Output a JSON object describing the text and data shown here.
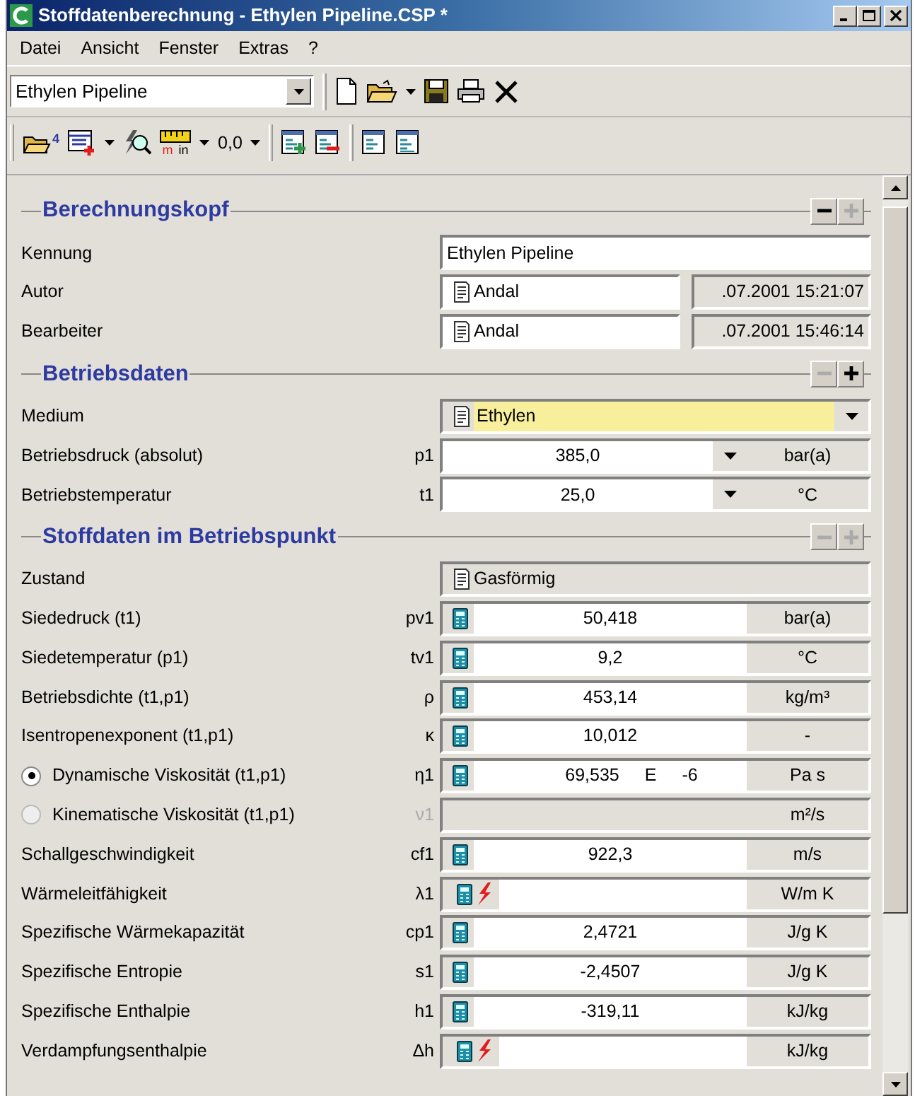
{
  "window": {
    "title": "Stoffdatenberechnung - Ethylen Pipeline.CSP *"
  },
  "menu": [
    "Datei",
    "Ansicht",
    "Fenster",
    "Extras",
    "?"
  ],
  "project_select": {
    "value": "Ethylen Pipeline"
  },
  "toolbar_2": {
    "recent_count": "4",
    "unit_metric": "m",
    "unit_imperial": "in",
    "number_format": "0,0"
  },
  "sections": [
    {
      "title": "Berechnungskopf",
      "collapse_enabled": true,
      "expand_enabled": false,
      "rows": [
        {
          "kind": "text",
          "label": "Kennung",
          "value": "Ethylen Pipeline"
        },
        {
          "kind": "person",
          "label": "Autor",
          "value": "Andal",
          "date": ".07.2001 15:21:07"
        },
        {
          "kind": "person",
          "label": "Bearbeiter",
          "value": "Andal",
          "date": ".07.2001 15:46:14"
        }
      ]
    },
    {
      "title": "Betriebsdaten",
      "collapse_enabled": false,
      "expand_enabled": true,
      "rows": [
        {
          "kind": "choice",
          "label": "Medium",
          "value": "Ethylen"
        },
        {
          "kind": "input",
          "label": "Betriebsdruck (absolut)",
          "symbol": "p1",
          "value": "385,0",
          "unit": "bar(a)"
        },
        {
          "kind": "input",
          "label": "Betriebstemperatur",
          "symbol": "t1",
          "value": "25,0",
          "unit": "°C"
        }
      ]
    },
    {
      "title": "Stoffdaten im Betriebspunkt",
      "collapse_enabled": false,
      "expand_enabled": false,
      "rows": [
        {
          "kind": "state",
          "label": "Zustand",
          "value": "Gasförmig"
        },
        {
          "kind": "calc",
          "label": "Siededruck (t1)",
          "symbol": "pv1",
          "value": "50,418",
          "unit": "bar(a)",
          "error": false
        },
        {
          "kind": "calc",
          "label": "Siedetemperatur (p1)",
          "symbol": "tv1",
          "value": "9,2",
          "unit": "°C",
          "error": false
        },
        {
          "kind": "calc",
          "label": "Betriebsdichte (t1,p1)",
          "symbol": "ρ",
          "value": "453,14",
          "unit": "kg/m³",
          "error": false
        },
        {
          "kind": "calc",
          "label": "Isentropenexponent (t1,p1)",
          "symbol": "κ",
          "value": "10,012",
          "unit": "-",
          "error": false
        },
        {
          "kind": "calc",
          "label": "Dynamische Viskosität (t1,p1)",
          "symbol": "η1",
          "value": "69,535",
          "exp_mark": "E",
          "exponent": "-6",
          "unit": "Pa s",
          "error": false,
          "radio": {
            "selected": true
          },
          "disabled": false
        },
        {
          "kind": "calc",
          "label": "Kinematische Viskosität (t1,p1)",
          "symbol": "ν1",
          "unit": "m²/s",
          "error": false,
          "radio": {
            "selected": false
          },
          "disabled": true
        },
        {
          "kind": "calc",
          "label": "Schallgeschwindigkeit",
          "symbol": "cf1",
          "value": "922,3",
          "unit": "m/s",
          "error": false
        },
        {
          "kind": "calc",
          "label": "Wärmeleitfähigkeit",
          "symbol": "λ1",
          "unit": "W/m K",
          "error": true
        },
        {
          "kind": "calc",
          "label": "Spezifische Wärmekapazität",
          "symbol": "cp1",
          "value": "2,4721",
          "unit": "J/g K",
          "error": false
        },
        {
          "kind": "calc",
          "label": "Spezifische Entropie",
          "symbol": "s1",
          "value": "-2,4507",
          "unit": "J/g K",
          "error": false
        },
        {
          "kind": "calc",
          "label": "Spezifische Enthalpie",
          "symbol": "h1",
          "value": "-319,11",
          "unit": "kJ/kg",
          "error": false
        },
        {
          "kind": "calc",
          "label": "Verdampfungsenthalpie",
          "symbol": "Δh",
          "unit": "kJ/kg",
          "error": true
        }
      ]
    }
  ]
}
